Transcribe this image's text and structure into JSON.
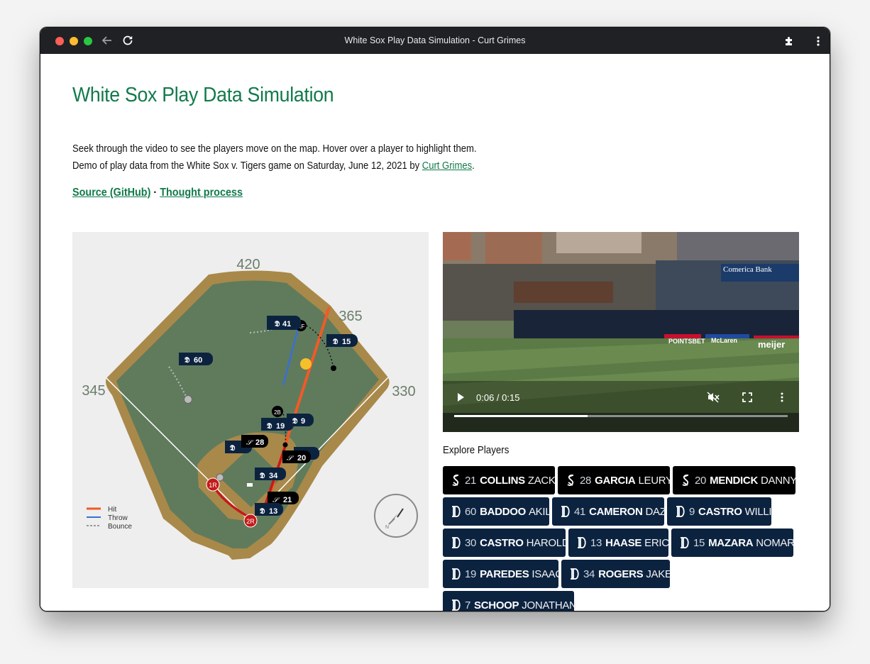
{
  "window": {
    "title": "White Sox Play Data Simulation - Curt Grimes"
  },
  "page": {
    "title": "White Sox Play Data Simulation",
    "line1": "Seek through the video to see the players move on the map. Hover over a player to highlight them.",
    "line2_prefix": "Demo of play data from the White Sox v. Tigers game on Saturday, June 12, 2021 by ",
    "author_link": "Curt Grimes",
    "line2_suffix": ".",
    "source_link": "Source (GitHub)",
    "separator": " · ",
    "thought_link": "Thought process"
  },
  "map": {
    "distances": {
      "center": "420",
      "right_center": "365",
      "left": "345",
      "right": "330"
    },
    "legend": {
      "hit": "Hit",
      "throw": "Throw",
      "bounce": "Bounce"
    },
    "bases": {
      "runner1": "1R",
      "runner2": "2R",
      "second_base": "2B",
      "right_field": "RF"
    },
    "markers": [
      "41",
      "15",
      "60",
      "19",
      "9",
      "28",
      "20",
      "34",
      "21",
      "13"
    ],
    "colors": {
      "hit": "#f05a28",
      "throw": "#3b6fd4",
      "bounce": "#999999",
      "grass": "#5f7b5c",
      "dirt": "#a8894a"
    }
  },
  "video": {
    "time": "0:06 / 0:15",
    "sign": "Comerica Bank",
    "ads": [
      "POINTSBET",
      "McLaren",
      "meijer"
    ],
    "progress": 0.4
  },
  "explore": {
    "label": "Explore Players",
    "players": [
      {
        "num": "21",
        "last": "COLLINS",
        "first": "ZACK",
        "team": "sox"
      },
      {
        "num": "28",
        "last": "GARCIA",
        "first": "LEURY",
        "team": "sox"
      },
      {
        "num": "20",
        "last": "MENDICK",
        "first": "DANNY",
        "team": "sox"
      },
      {
        "num": "60",
        "last": "BADDOO",
        "first": "AKIL",
        "team": "tigers"
      },
      {
        "num": "41",
        "last": "CAMERON",
        "first": "DAZ",
        "team": "tigers"
      },
      {
        "num": "9",
        "last": "CASTRO",
        "first": "WILLI",
        "team": "tigers"
      },
      {
        "num": "30",
        "last": "CASTRO",
        "first": "HAROLD",
        "team": "tigers"
      },
      {
        "num": "13",
        "last": "HAASE",
        "first": "ERIC",
        "team": "tigers"
      },
      {
        "num": "15",
        "last": "MAZARA",
        "first": "NOMAR",
        "team": "tigers"
      },
      {
        "num": "19",
        "last": "PAREDES",
        "first": "ISAAC",
        "team": "tigers"
      },
      {
        "num": "34",
        "last": "ROGERS",
        "first": "JAKE",
        "team": "tigers"
      },
      {
        "num": "7",
        "last": "SCHOOP",
        "first": "JONATHAN",
        "team": "tigers"
      }
    ]
  }
}
